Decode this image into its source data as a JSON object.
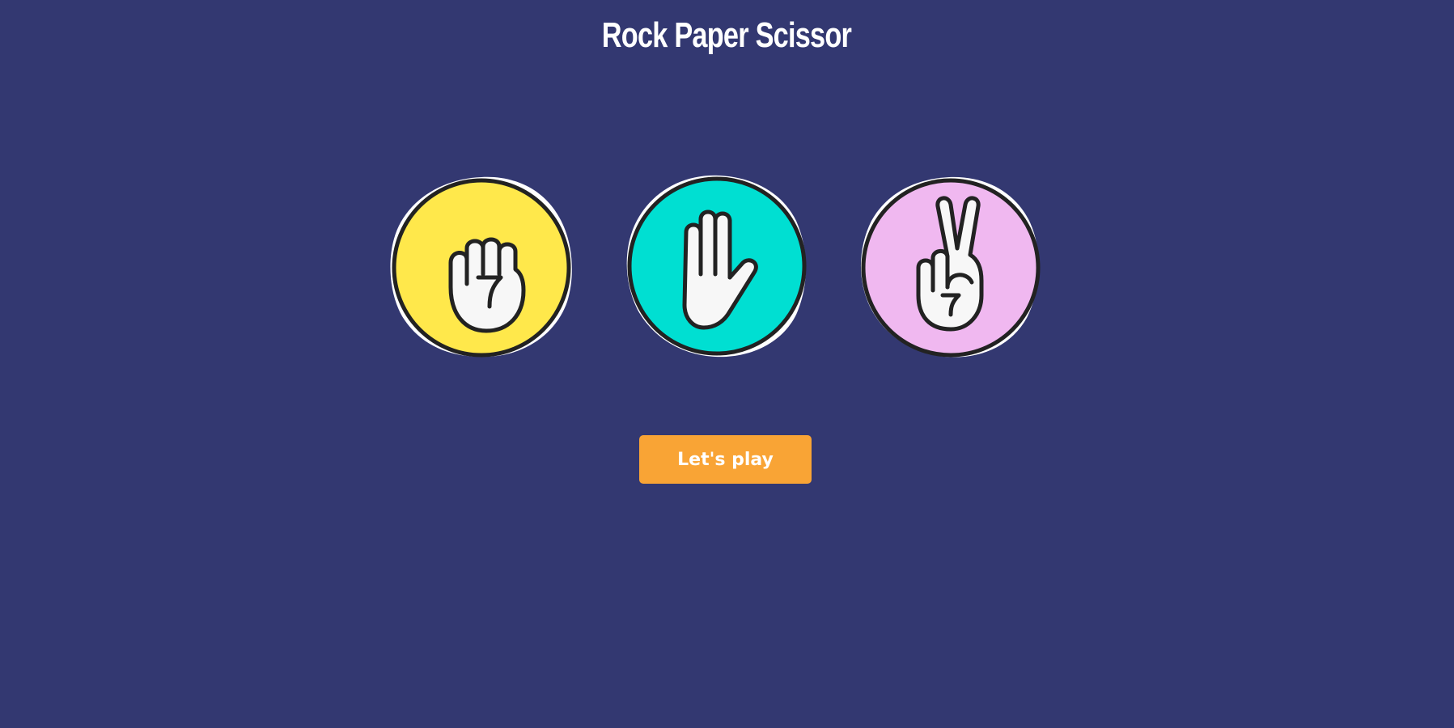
{
  "title": "Rock Paper Scissor",
  "choices": [
    {
      "id": "rock",
      "icon": "fist-icon",
      "color": "#ffe84b"
    },
    {
      "id": "paper",
      "icon": "open-hand-icon",
      "color": "#00dfd2"
    },
    {
      "id": "scissors",
      "icon": "peace-hand-icon",
      "color": "#f0b8f0"
    }
  ],
  "play_button": {
    "label": "Let's play",
    "color": "#f9a435"
  },
  "colors": {
    "background": "#333871",
    "outline": "#222222",
    "hand": "#f7f7f7"
  }
}
